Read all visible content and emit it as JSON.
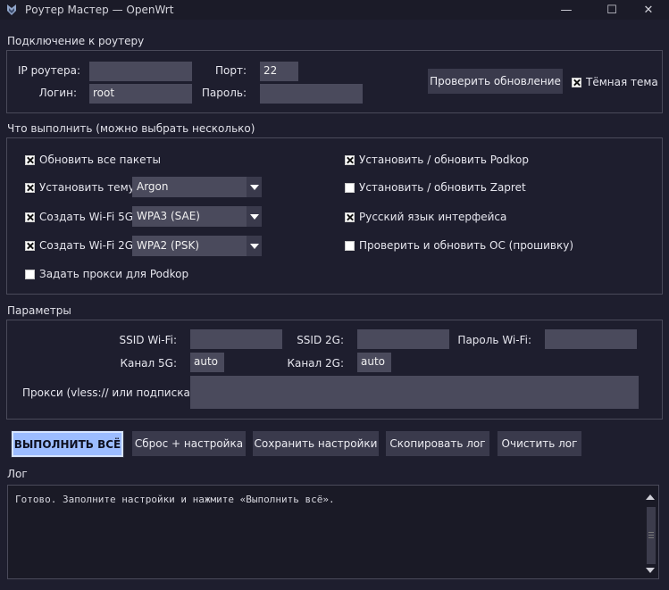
{
  "window": {
    "title": "Роутер Мастер — OpenWrt",
    "minimize_glyph": "—",
    "maximize_glyph": "☐",
    "close_glyph": "✕"
  },
  "connection": {
    "section_title": "Подключение к роутеру",
    "ip_label": "IP роутера:",
    "ip_value": "",
    "port_label": "Порт:",
    "port_value": "22",
    "login_label": "Логин:",
    "login_value": "root",
    "password_label": "Пароль:",
    "password_value": "",
    "check_update_button": "Проверить обновление",
    "dark_theme_label": "Тёмная тема",
    "dark_theme_checked": true
  },
  "tasks": {
    "section_title": "Что выполнить (можно выбрать несколько)",
    "update_packages": {
      "label": "Обновить все пакеты",
      "checked": true
    },
    "install_theme": {
      "label": "Установить тему:",
      "checked": true,
      "selected": "Argon"
    },
    "wifi5g": {
      "label": "Создать Wi-Fi 5G:",
      "checked": true,
      "selected": "WPA3 (SAE)"
    },
    "wifi2g": {
      "label": "Создать Wi-Fi 2G:",
      "checked": true,
      "selected": "WPA2 (PSK)"
    },
    "proxy_podkop": {
      "label": "Задать прокси для Podkop",
      "checked": false
    },
    "install_podkop": {
      "label": "Установить / обновить Podkop",
      "checked": true
    },
    "install_zapret": {
      "label": "Установить / обновить Zapret",
      "checked": false
    },
    "russian_ui": {
      "label": "Русский язык интерфейса",
      "checked": true
    },
    "update_os": {
      "label": "Проверить и обновить ОС (прошивку)",
      "checked": false
    }
  },
  "params": {
    "section_title": "Параметры",
    "ssid_wifi_label": "SSID Wi-Fi:",
    "ssid_wifi_value": "",
    "ssid_2g_label": "SSID 2G:",
    "ssid_2g_value": "",
    "wifi_password_label": "Пароль Wi-Fi:",
    "wifi_password_value": "",
    "channel_5g_label": "Канал 5G:",
    "channel_5g_value": "auto",
    "channel_2g_label": "Канал 2G:",
    "channel_2g_value": "auto",
    "proxy_label": "Прокси (vless:// или подписка):",
    "proxy_value": ""
  },
  "actions": {
    "run_all": "ВЫПОЛНИТЬ ВСЁ",
    "reset_setup": "Сброс + настройка",
    "save_settings": "Сохранить настройки",
    "copy_log": "Скопировать лог",
    "clear_log": "Очистить лог"
  },
  "log": {
    "section_title": "Лог",
    "text": "Готово. Заполните настройки и нажмите «Выполнить всё»."
  },
  "colors": {
    "background": "#1e1e2e",
    "field": "#4a4a5c",
    "button": "#3a3a4c",
    "accent": "#9cbcff"
  }
}
